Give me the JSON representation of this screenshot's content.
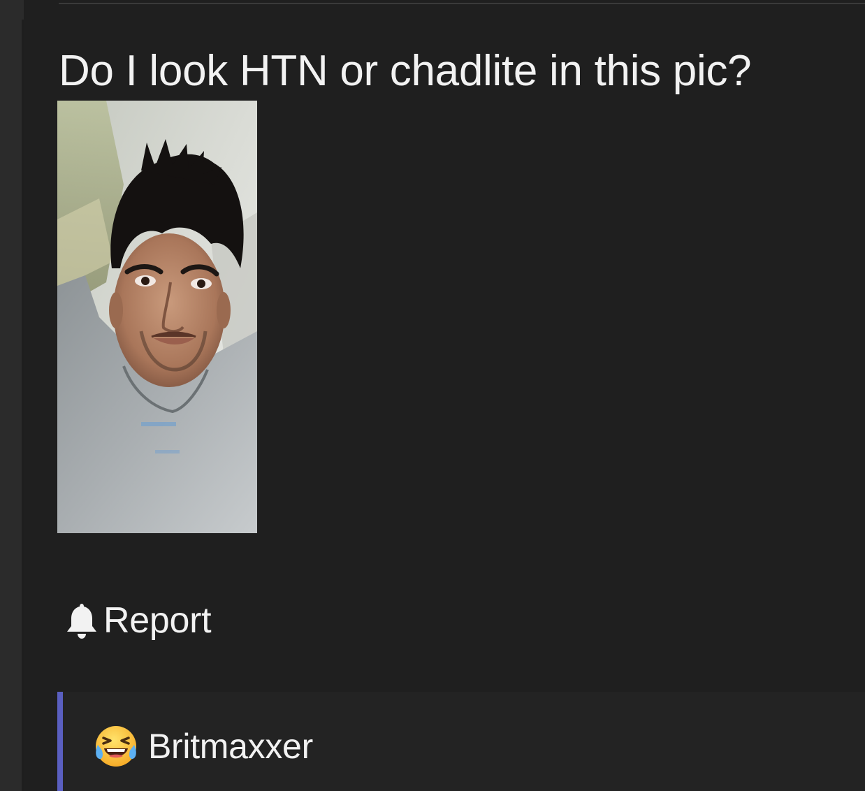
{
  "post": {
    "title": "Do I look HTN or chadlite in this pic?",
    "report_label": "Report"
  },
  "reply": {
    "author": "Britmaxxer",
    "author_icon": "laughing-crying-emoji-icon"
  },
  "colors": {
    "background": "#1f1f1f",
    "text": "#f2f2f2",
    "reply_accent": "#5a5fc0"
  },
  "icons": {
    "report": "bell-icon"
  }
}
